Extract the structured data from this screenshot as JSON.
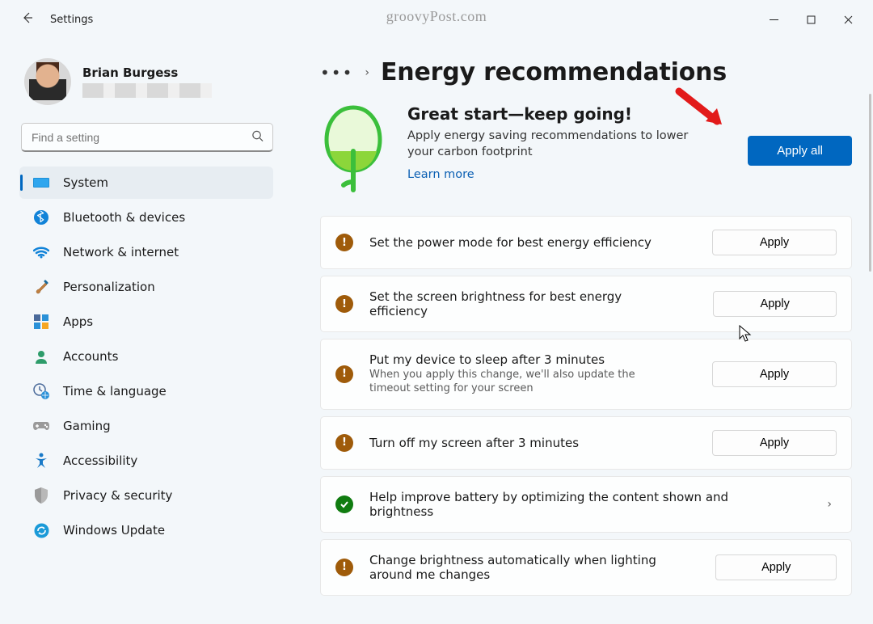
{
  "watermark": "groovyPost.com",
  "window": {
    "title": "Settings"
  },
  "profile": {
    "name": "Brian Burgess"
  },
  "search": {
    "placeholder": "Find a setting"
  },
  "sidebar": {
    "items": [
      {
        "label": "System"
      },
      {
        "label": "Bluetooth & devices"
      },
      {
        "label": "Network & internet"
      },
      {
        "label": "Personalization"
      },
      {
        "label": "Apps"
      },
      {
        "label": "Accounts"
      },
      {
        "label": "Time & language"
      },
      {
        "label": "Gaming"
      },
      {
        "label": "Accessibility"
      },
      {
        "label": "Privacy & security"
      },
      {
        "label": "Windows Update"
      }
    ]
  },
  "page": {
    "title": "Energy recommendations",
    "banner": {
      "heading": "Great start—keep going!",
      "body": "Apply energy saving recommendations to lower your carbon footprint",
      "learn_more": "Learn more",
      "apply_all": "Apply all"
    },
    "recommendations": [
      {
        "status": "warn",
        "title": "Set the power mode for best energy efficiency",
        "sub": "",
        "action": "Apply"
      },
      {
        "status": "warn",
        "title": "Set the screen brightness for best energy efficiency",
        "sub": "",
        "action": "Apply"
      },
      {
        "status": "warn",
        "title": "Put my device to sleep after 3 minutes",
        "sub": "When you apply this change, we'll also update the timeout setting for your screen",
        "action": "Apply"
      },
      {
        "status": "warn",
        "title": "Turn off my screen after 3 minutes",
        "sub": "",
        "action": "Apply"
      },
      {
        "status": "ok",
        "title": "Help improve battery by optimizing the content shown and brightness",
        "sub": "",
        "action": "chevron"
      },
      {
        "status": "warn",
        "title": "Change brightness automatically when lighting around me changes",
        "sub": "",
        "action": "Apply"
      }
    ]
  }
}
